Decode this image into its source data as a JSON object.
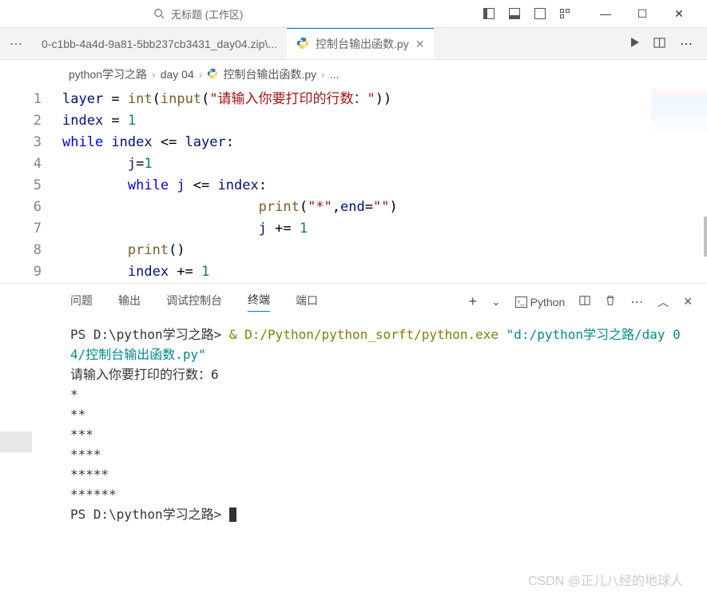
{
  "titlebar": {
    "search_placeholder": "无标题 (工作区)"
  },
  "tabs": {
    "inactive": "0-c1bb-4a4d-9a81-5bb237cb3431_day04.zip\\...",
    "active": "控制台输出函数.py"
  },
  "breadcrumb": [
    "python学习之路",
    "day 04",
    "控制台输出函数.py",
    "..."
  ],
  "code_lines": [
    {
      "n": 1,
      "tokens": [
        {
          "t": "layer ",
          "c": "var"
        },
        {
          "t": "= ",
          "c": "op"
        },
        {
          "t": "int",
          "c": "fn"
        },
        {
          "t": "(",
          "c": "op"
        },
        {
          "t": "input",
          "c": "fn"
        },
        {
          "t": "(",
          "c": "op"
        },
        {
          "t": "\"请输入你要打印的行数：\"",
          "c": "str"
        },
        {
          "t": "))",
          "c": "op"
        }
      ]
    },
    {
      "n": 2,
      "tokens": [
        {
          "t": "index ",
          "c": "var"
        },
        {
          "t": "= ",
          "c": "op"
        },
        {
          "t": "1",
          "c": "num"
        }
      ]
    },
    {
      "n": 3,
      "tokens": [
        {
          "t": "while ",
          "c": "kw"
        },
        {
          "t": "index ",
          "c": "var"
        },
        {
          "t": "<= ",
          "c": "op"
        },
        {
          "t": "layer",
          "c": "var"
        },
        {
          "t": ":",
          "c": "op"
        }
      ]
    },
    {
      "n": 4,
      "indent": 2,
      "tokens": [
        {
          "t": "j",
          "c": "var"
        },
        {
          "t": "=",
          "c": "op"
        },
        {
          "t": "1",
          "c": "num"
        }
      ]
    },
    {
      "n": 5,
      "indent": 2,
      "tokens": [
        {
          "t": "while ",
          "c": "kw"
        },
        {
          "t": "j ",
          "c": "var"
        },
        {
          "t": "<= ",
          "c": "op"
        },
        {
          "t": "index",
          "c": "var"
        },
        {
          "t": ":",
          "c": "op"
        }
      ]
    },
    {
      "n": 6,
      "indent": 6,
      "tokens": [
        {
          "t": "print",
          "c": "fn"
        },
        {
          "t": "(",
          "c": "op"
        },
        {
          "t": "\"*\"",
          "c": "str"
        },
        {
          "t": ",",
          "c": "op"
        },
        {
          "t": "end",
          "c": "var"
        },
        {
          "t": "=",
          "c": "op"
        },
        {
          "t": "\"\"",
          "c": "str"
        },
        {
          "t": ")",
          "c": "op"
        }
      ]
    },
    {
      "n": 7,
      "indent": 6,
      "tokens": [
        {
          "t": "j ",
          "c": "var"
        },
        {
          "t": "+= ",
          "c": "op"
        },
        {
          "t": "1",
          "c": "num"
        }
      ]
    },
    {
      "n": 8,
      "indent": 2,
      "tokens": [
        {
          "t": "print",
          "c": "fn"
        },
        {
          "t": "()",
          "c": "op"
        }
      ]
    },
    {
      "n": 9,
      "indent": 2,
      "tokens": [
        {
          "t": "index ",
          "c": "var"
        },
        {
          "t": "+= ",
          "c": "op"
        },
        {
          "t": "1",
          "c": "num"
        }
      ]
    }
  ],
  "panel": {
    "tabs": [
      "问题",
      "输出",
      "调试控制台",
      "终端",
      "端口"
    ],
    "active_index": 3,
    "launch_label": "Python"
  },
  "terminal": {
    "prompt1_pre": "PS D:\\python学习之路> ",
    "amp": "&",
    "exe": " D:/Python/python_sorft/python.exe ",
    "arg": "\"d:/python学习之路/day 04/控制台输出函数.py\"",
    "input_line": "请输入你要打印的行数：6",
    "output_lines": [
      "*",
      "**",
      "***",
      "****",
      "*****",
      "******"
    ],
    "prompt2": "PS D:\\python学习之路> "
  },
  "watermark": "CSDN @正儿八经的地球人"
}
